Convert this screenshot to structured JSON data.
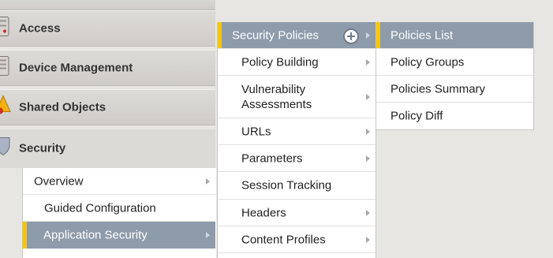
{
  "sidebar": {
    "items": [
      {
        "label": "Access",
        "icon": "server-icon"
      },
      {
        "label": "Device Management",
        "icon": "device-icon"
      },
      {
        "label": "Shared Objects",
        "icon": "warning-shield-icon"
      },
      {
        "label": "Security",
        "icon": "shield-icon"
      }
    ],
    "security_submenu": [
      {
        "label": "Overview"
      },
      {
        "label": "Guided Configuration"
      },
      {
        "label": "Application Security"
      }
    ]
  },
  "menu_level2": {
    "header": "Security Policies",
    "items": [
      {
        "label": "Policy Building"
      },
      {
        "label": "Vulnerability",
        "label2": "Assessments"
      },
      {
        "label": "URLs"
      },
      {
        "label": "Parameters"
      },
      {
        "label": "Session Tracking"
      },
      {
        "label": "Headers"
      },
      {
        "label": "Content Profiles"
      }
    ]
  },
  "menu_level3": {
    "items": [
      {
        "label": "Policies List"
      },
      {
        "label": "Policy Groups"
      },
      {
        "label": "Policies Summary"
      },
      {
        "label": "Policy Diff"
      }
    ]
  },
  "colors": {
    "selected": "#8e9bab",
    "accent": "#f7c600",
    "background": "#e8e6e3"
  }
}
